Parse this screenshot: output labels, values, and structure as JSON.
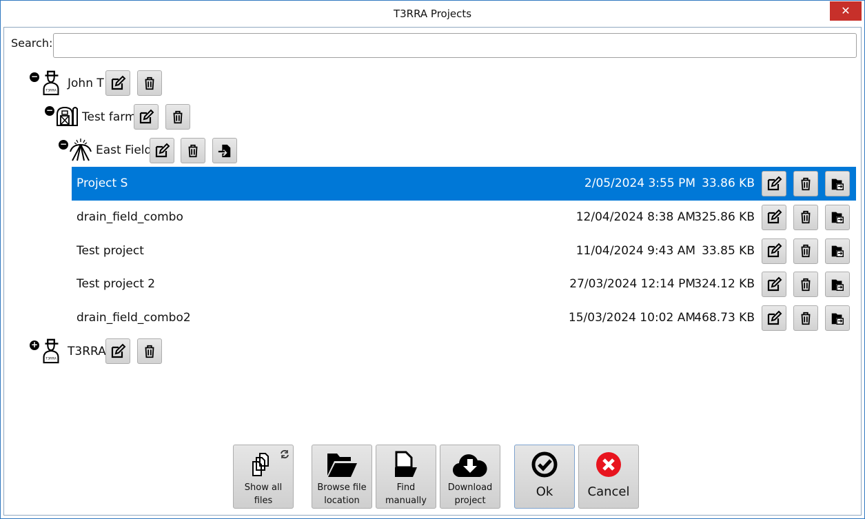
{
  "window": {
    "title": "T3RRA Projects",
    "close": "✕"
  },
  "search": {
    "label": "Search:",
    "value": ""
  },
  "tree": {
    "user1": {
      "name": "John T",
      "toggle": "−"
    },
    "farm": {
      "name": "Test farm",
      "toggle": "−"
    },
    "field": {
      "name": "East Field",
      "toggle": "−"
    },
    "projects": [
      {
        "name": "Project S",
        "date": "2/05/2024 3:55 PM",
        "size": "33.86 KB",
        "selected": true
      },
      {
        "name": "drain_field_combo",
        "date": "12/04/2024 8:38 AM",
        "size": "325.86 KB"
      },
      {
        "name": "Test project",
        "date": "11/04/2024 9:43 AM",
        "size": "33.85 KB"
      },
      {
        "name": "Test project 2",
        "date": "27/03/2024 12:14 PM",
        "size": "324.12 KB"
      },
      {
        "name": "drain_field_combo2",
        "date": "15/03/2024 10:02 AM",
        "size": "468.73 KB"
      }
    ],
    "user2": {
      "name": "T3RRA",
      "toggle": "+"
    }
  },
  "buttons": {
    "show_all_1": "Show all",
    "show_all_2": "files",
    "browse_1": "Browse file",
    "browse_2": "location",
    "find_1": "Find",
    "find_2": "manually",
    "download_1": "Download",
    "download_2": "project",
    "ok": "Ok",
    "cancel": "Cancel"
  },
  "colors": {
    "selected": "#0078d7",
    "cancel": "#e8141e"
  }
}
